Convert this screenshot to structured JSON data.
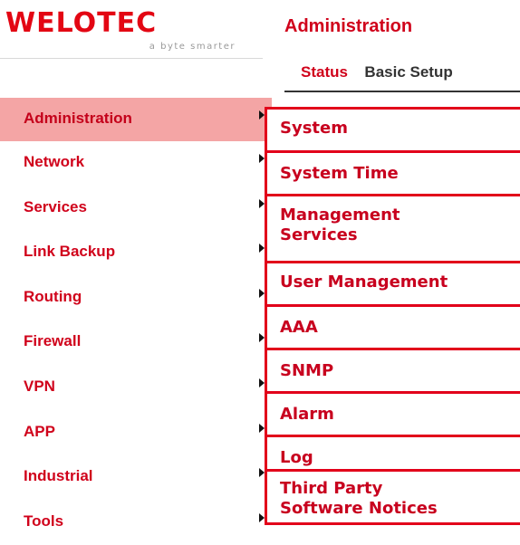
{
  "brand": {
    "logo_text": "WELOTEC",
    "tagline": "a byte smarter",
    "color": "#e30613"
  },
  "header": {
    "title": "Administration",
    "tabs": [
      {
        "label": "Status",
        "active": true
      },
      {
        "label": "Basic Setup",
        "active": false
      }
    ]
  },
  "sidebar": {
    "items": [
      {
        "label": "Administration",
        "active": true
      },
      {
        "label": "Network"
      },
      {
        "label": "Services"
      },
      {
        "label": "Link Backup"
      },
      {
        "label": "Routing"
      },
      {
        "label": "Firewall"
      },
      {
        "label": "VPN"
      },
      {
        "label": "APP"
      },
      {
        "label": "Industrial"
      },
      {
        "label": "Tools"
      }
    ]
  },
  "submenu": {
    "items": [
      {
        "label": "System"
      },
      {
        "label": "System Time"
      },
      {
        "label": "Management",
        "label2": "Services"
      },
      {
        "label": "User Management"
      },
      {
        "label": "AAA"
      },
      {
        "label": "SNMP"
      },
      {
        "label": "Alarm"
      },
      {
        "label": "Log"
      },
      {
        "label": "Third Party",
        "label2": "Software Notices"
      }
    ]
  },
  "colors": {
    "accent": "#d0021b",
    "active_bg": "#f4a5a5",
    "submenu_border": "#e2001a"
  }
}
